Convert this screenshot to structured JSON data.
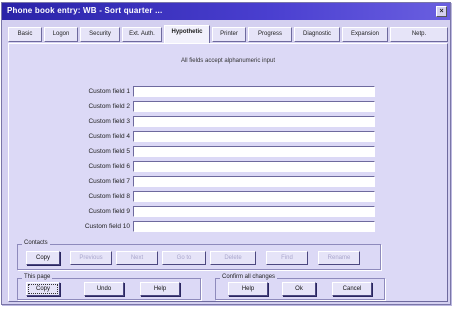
{
  "window": {
    "title": "Phone book entry: WB - Sort quarter ...",
    "close_label": "×"
  },
  "tabs": [
    {
      "label": "Basic"
    },
    {
      "label": "Logon"
    },
    {
      "label": "Security"
    },
    {
      "label": "Ext. Auth."
    },
    {
      "label": "Hypothetic"
    },
    {
      "label": "Printer"
    },
    {
      "label": "Progress"
    },
    {
      "label": "Diagnostic"
    },
    {
      "label": "Expansion"
    },
    {
      "label": "Netp."
    }
  ],
  "active_tab_index": 4,
  "note": "All fields accept alphanumeric input",
  "custom_fields": [
    {
      "label": "Custom field 1",
      "value": ""
    },
    {
      "label": "Custom field 2",
      "value": ""
    },
    {
      "label": "Custom field 3",
      "value": ""
    },
    {
      "label": "Custom field 4",
      "value": ""
    },
    {
      "label": "Custom field 5",
      "value": ""
    },
    {
      "label": "Custom field 6",
      "value": ""
    },
    {
      "label": "Custom field 7",
      "value": ""
    },
    {
      "label": "Custom field 8",
      "value": ""
    },
    {
      "label": "Custom field 9",
      "value": ""
    },
    {
      "label": "Custom field 10",
      "value": ""
    }
  ],
  "contacts": {
    "legend": "Contacts",
    "buttons": [
      {
        "label": "Copy",
        "enabled": true
      },
      {
        "label": "Previous",
        "enabled": false
      },
      {
        "label": "Next",
        "enabled": false
      },
      {
        "label": "Go to",
        "enabled": false
      },
      {
        "label": "Delete",
        "enabled": false
      },
      {
        "label": "Find",
        "enabled": false
      },
      {
        "label": "Rename",
        "enabled": false
      }
    ]
  },
  "this_page": {
    "legend": "This page",
    "buttons": [
      {
        "label": "Copy"
      },
      {
        "label": "Undo"
      },
      {
        "label": "Help"
      }
    ]
  },
  "confirm": {
    "legend": "Confirm all changes",
    "buttons": [
      {
        "label": "Help"
      },
      {
        "label": "Ok"
      },
      {
        "label": "Cancel"
      }
    ]
  },
  "colors": {
    "titlebar": "#2a23a8",
    "panel": "#dcd9f6",
    "button_face": "#e6e4f8"
  }
}
